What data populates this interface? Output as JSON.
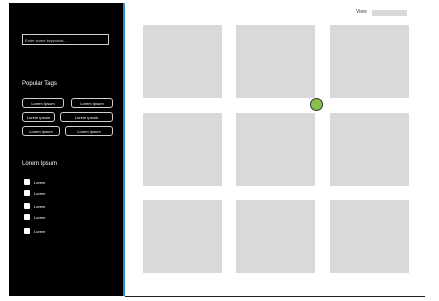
{
  "sidebar": {
    "search_placeholder": "Enter some keywords...",
    "popular_tags_title": "Popular Tags",
    "tags": [
      "Lorem Ipsum",
      "Lorem Ipsum",
      "Lorem Ipsum",
      "Lorem Ipsum",
      "Lorem Ipsum",
      "Lorem Ipsum"
    ],
    "filter_title": "Lorem Ipsum",
    "checkboxes": [
      "Lorem",
      "Lorem",
      "Lorem",
      "Lorem",
      "Lorem"
    ]
  },
  "header": {
    "view_label": "View"
  },
  "colors": {
    "sidebar_bg": "#000000",
    "sidebar_border": "#2b8fd8",
    "tile_bg": "#d9d9d9",
    "accent_dot": "#87c04a"
  }
}
